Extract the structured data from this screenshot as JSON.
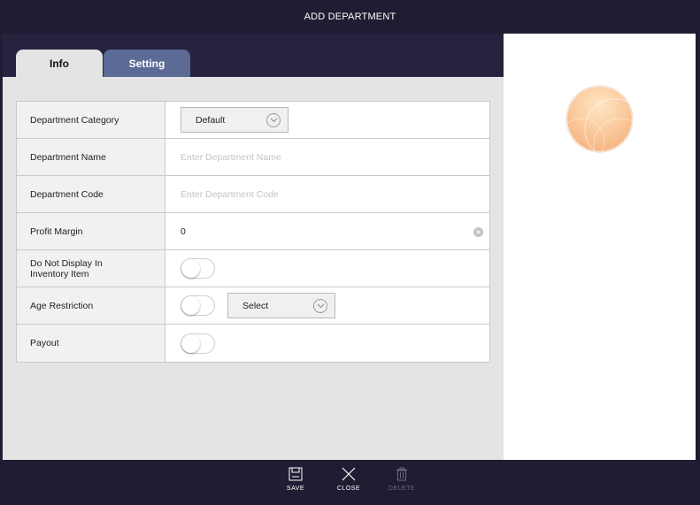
{
  "window": {
    "title": "ADD DEPARTMENT"
  },
  "tabs": [
    {
      "label": "Info",
      "active": true
    },
    {
      "label": "Setting",
      "active": false
    }
  ],
  "form": {
    "department_category": {
      "label": "Department Category",
      "value": "Default"
    },
    "department_name": {
      "label": "Department Name",
      "value": "",
      "placeholder": "Enter Department Name"
    },
    "department_code": {
      "label": "Department Code",
      "value": "",
      "placeholder": "Enter Department Code"
    },
    "profit_margin": {
      "label": "Profit Margin",
      "value": "0"
    },
    "do_not_display": {
      "label_line1": "Do Not Display In",
      "label_line2": "Inventory Item",
      "enabled": false
    },
    "age_restriction": {
      "label": "Age Restriction",
      "enabled": false,
      "select_value": "Select"
    },
    "payout": {
      "label": "Payout",
      "enabled": false
    }
  },
  "footer": {
    "save_label": "SAVE",
    "close_label": "CLOSE",
    "delete_label": "DELETE"
  },
  "colors": {
    "header_bg": "#1f1d33",
    "active_tab": "#e4e4e4",
    "inactive_tab": "#5b6b95",
    "avatar_gradient_start": "#ffd9a8",
    "avatar_gradient_end": "#f7b27a"
  },
  "icons": {
    "save": "floppy-disk-icon",
    "close": "x-icon",
    "delete": "trash-icon",
    "dropdown": "chevron-down-icon",
    "clear": "clear-icon"
  }
}
